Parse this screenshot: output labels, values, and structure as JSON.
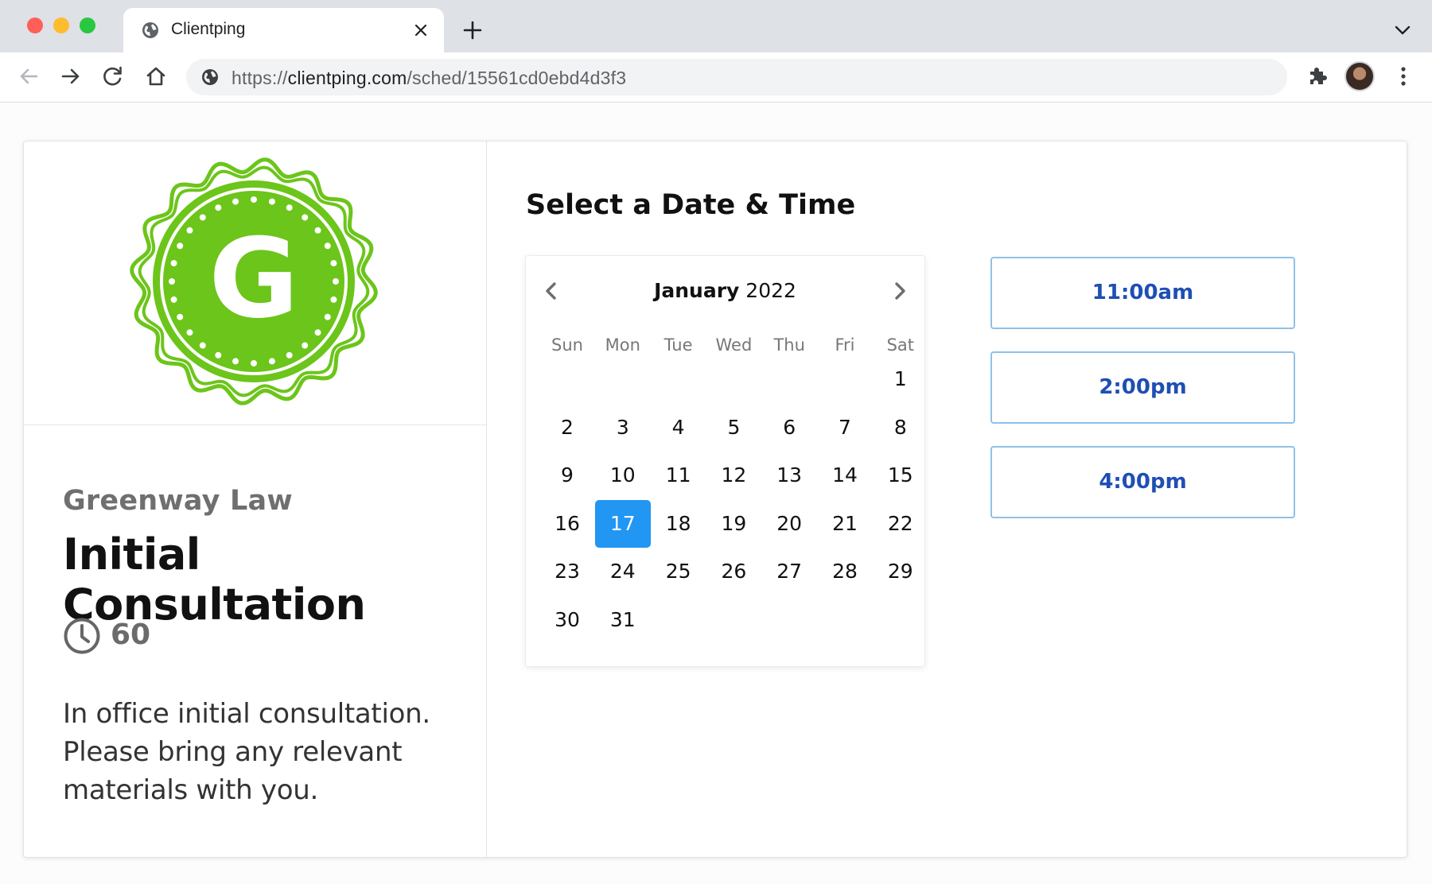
{
  "browser": {
    "tab_title": "Clientping",
    "url": {
      "scheme": "https://",
      "host": "clientping.com",
      "path": "/sched/15561cd0ebd4d3f3"
    }
  },
  "page": {
    "logo": {
      "letter": "G",
      "color": "#6cc51a"
    },
    "company": "Greenway Law",
    "event_title": "Initial Consultation",
    "duration": "60",
    "description_lines": [
      "In office initial consultation.",
      "Please bring any relevant",
      "materials with you."
    ],
    "section_title": "Select a Date & Time",
    "calendar": {
      "month": "January",
      "year": "2022",
      "weekdays": [
        "Sun",
        "Mon",
        "Tue",
        "Wed",
        "Thu",
        "Fri",
        "Sat"
      ],
      "first_weekday_index": 6,
      "days_in_month": 31,
      "selected_day": 17,
      "accent_color": "#2196f3"
    },
    "time_slots": [
      "11:00am",
      "2:00pm",
      "4:00pm"
    ]
  }
}
